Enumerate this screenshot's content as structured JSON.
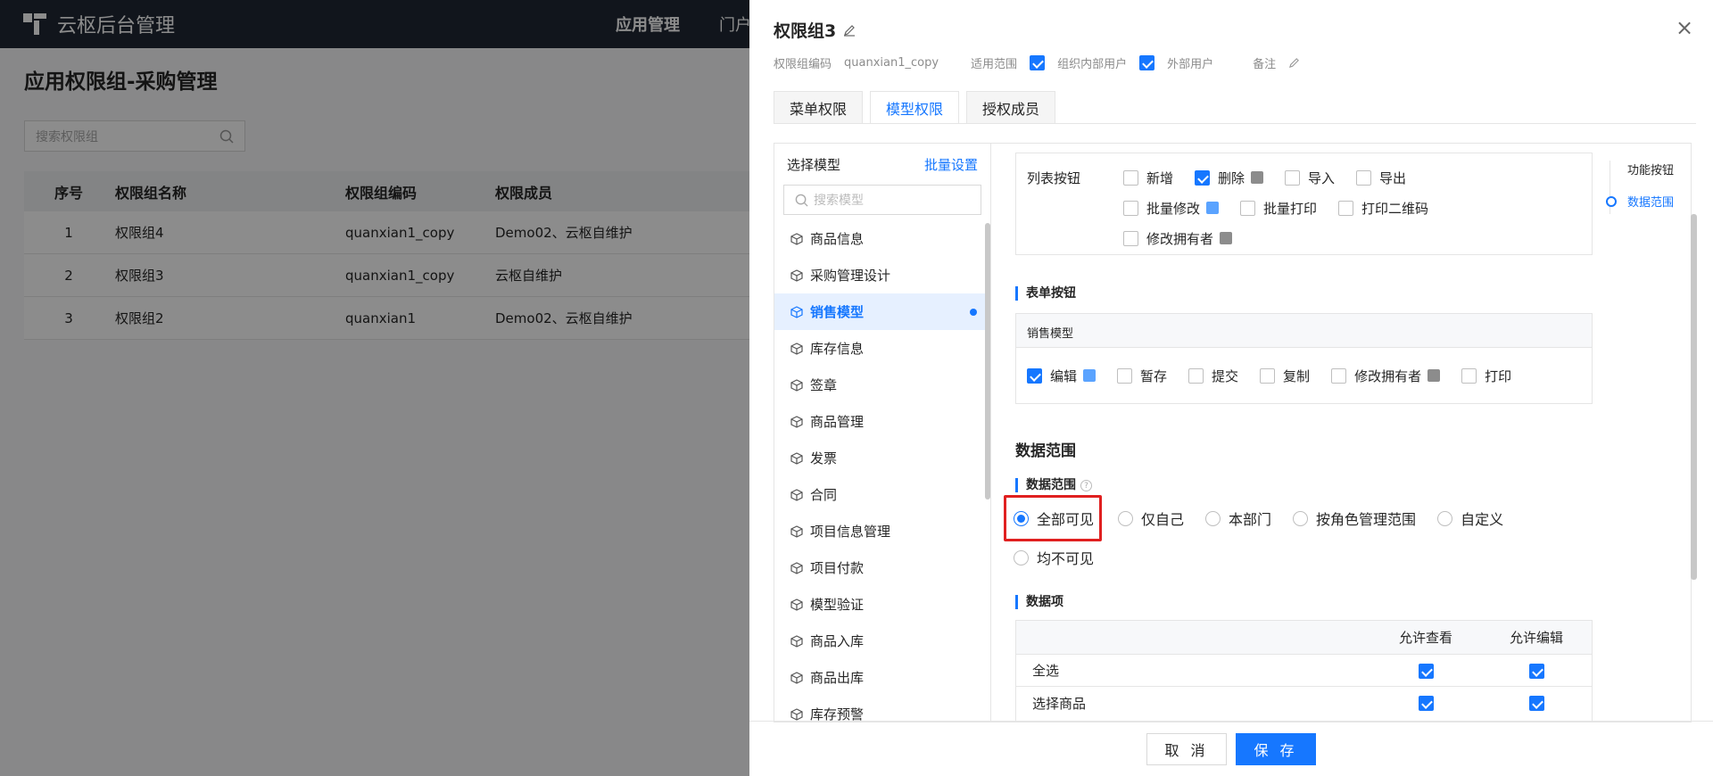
{
  "app": {
    "name": "云枢后台管理",
    "nav": [
      "应用管理",
      "门户"
    ]
  },
  "page": {
    "title": "应用权限组-采购管理",
    "search_placeholder": "搜索权限组",
    "table": {
      "headers": [
        "序号",
        "权限组名称",
        "权限组编码",
        "权限成员"
      ],
      "rows": [
        [
          "1",
          "权限组4",
          "quanxian1_copy",
          "Demo02、云枢自维护"
        ],
        [
          "2",
          "权限组3",
          "quanxian1_copy",
          "云枢自维护"
        ],
        [
          "3",
          "权限组2",
          "quanxian1",
          "Demo02、云枢自维护"
        ]
      ]
    }
  },
  "drawer": {
    "title": "权限组3",
    "code_label": "权限组编码",
    "code_value": "quanxian1_copy",
    "scope_label": "适用范围",
    "scope_internal": "组织内部用户",
    "scope_external": "外部用户",
    "remark_label": "备注",
    "tabs": [
      "菜单权限",
      "模型权限",
      "授权成员"
    ],
    "model_list": {
      "header": "选择模型",
      "batch": "批量设置",
      "search_placeholder": "搜索模型",
      "items": [
        "商品信息",
        "采购管理设计",
        "销售模型",
        "库存信息",
        "签章",
        "商品管理",
        "发票",
        "合同",
        "项目信息管理",
        "项目付款",
        "模型验证",
        "商品入库",
        "商品出库",
        "库存预警"
      ]
    },
    "list_buttons": {
      "label": "列表按钮",
      "options": [
        {
          "label": "新增",
          "checked": false
        },
        {
          "label": "删除",
          "checked": true
        },
        {
          "label": "导入",
          "checked": false
        },
        {
          "label": "导出",
          "checked": false
        },
        {
          "label": "批量修改",
          "checked": false
        },
        {
          "label": "批量打印",
          "checked": false
        },
        {
          "label": "打印二维码",
          "checked": false
        },
        {
          "label": "修改拥有者",
          "checked": false
        }
      ]
    },
    "form_buttons": {
      "title": "表单按钮",
      "model_name": "销售模型",
      "options": [
        {
          "label": "编辑",
          "checked": true
        },
        {
          "label": "暂存",
          "checked": false
        },
        {
          "label": "提交",
          "checked": false
        },
        {
          "label": "复制",
          "checked": false
        },
        {
          "label": "修改拥有者",
          "checked": false
        },
        {
          "label": "打印",
          "checked": false
        }
      ]
    },
    "data_scope": {
      "heading": "数据范围",
      "label": "数据范围",
      "options": [
        "全部可见",
        "仅自己",
        "本部门",
        "按角色管理范围",
        "自定义",
        "均不可见"
      ],
      "selected": "全部可见"
    },
    "data_items": {
      "title": "数据项",
      "col_view": "允许查看",
      "col_edit": "允许编辑",
      "rows": [
        "全选",
        "选择商品"
      ]
    },
    "anchor": [
      "功能按钮",
      "数据范围"
    ],
    "footer": {
      "cancel": "取 消",
      "save": "保 存"
    }
  },
  "colors": {
    "accent": "#1677ff",
    "highlight": "#e02020",
    "topbar": "#1f2733"
  }
}
